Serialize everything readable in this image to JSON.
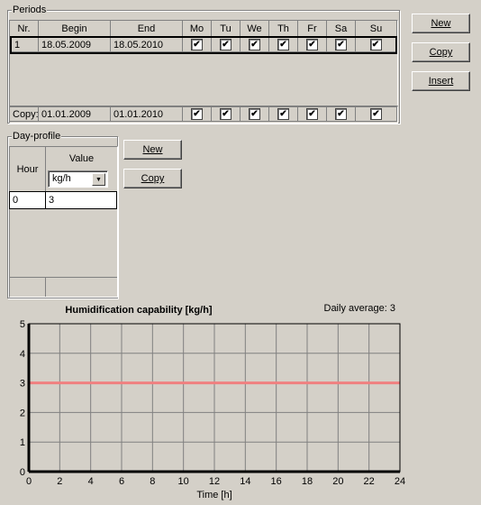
{
  "periods": {
    "group_label": "Periods",
    "columns": [
      "Nr.",
      "Begin",
      "End",
      "Mo",
      "Tu",
      "We",
      "Th",
      "Fr",
      "Sa",
      "Su"
    ],
    "rows": [
      {
        "nr": "1",
        "begin": "18.05.2009",
        "end": "18.05.2010",
        "days": [
          true,
          true,
          true,
          true,
          true,
          true,
          true
        ]
      }
    ],
    "copy_row": {
      "label": "Copy:",
      "begin": "01.01.2009",
      "end": "01.01.2010",
      "days": [
        true,
        true,
        true,
        true,
        true,
        true,
        true
      ]
    },
    "buttons": {
      "new": "New",
      "copy": "Copy",
      "insert": "Insert"
    }
  },
  "day_profile": {
    "group_label": "Day-profile",
    "col_hour": "Hour",
    "col_value": "Value",
    "unit_selected": "kg/h",
    "rows": [
      {
        "hour": "0",
        "value": "3"
      }
    ],
    "buttons": {
      "new": "New",
      "copy": "Copy"
    }
  },
  "check_glyph": "✔",
  "dropdown_glyph": "▼",
  "chart_data": {
    "type": "line",
    "title": "Humidification capability [kg/h]",
    "annotation": "Daily average: 3",
    "xlabel": "Time [h]",
    "ylabel": "",
    "xlim": [
      0,
      24
    ],
    "ylim": [
      0,
      5
    ],
    "x_ticks": [
      "0",
      "2",
      "4",
      "6",
      "8",
      "10",
      "12",
      "14",
      "16",
      "18",
      "20",
      "22",
      "24"
    ],
    "y_ticks": [
      "0",
      "1",
      "2",
      "3",
      "4",
      "5"
    ],
    "grid": true,
    "series": [
      {
        "name": "Humidification capability",
        "color": "#f08080",
        "x": [
          0,
          24
        ],
        "y": [
          3,
          3
        ]
      }
    ]
  }
}
